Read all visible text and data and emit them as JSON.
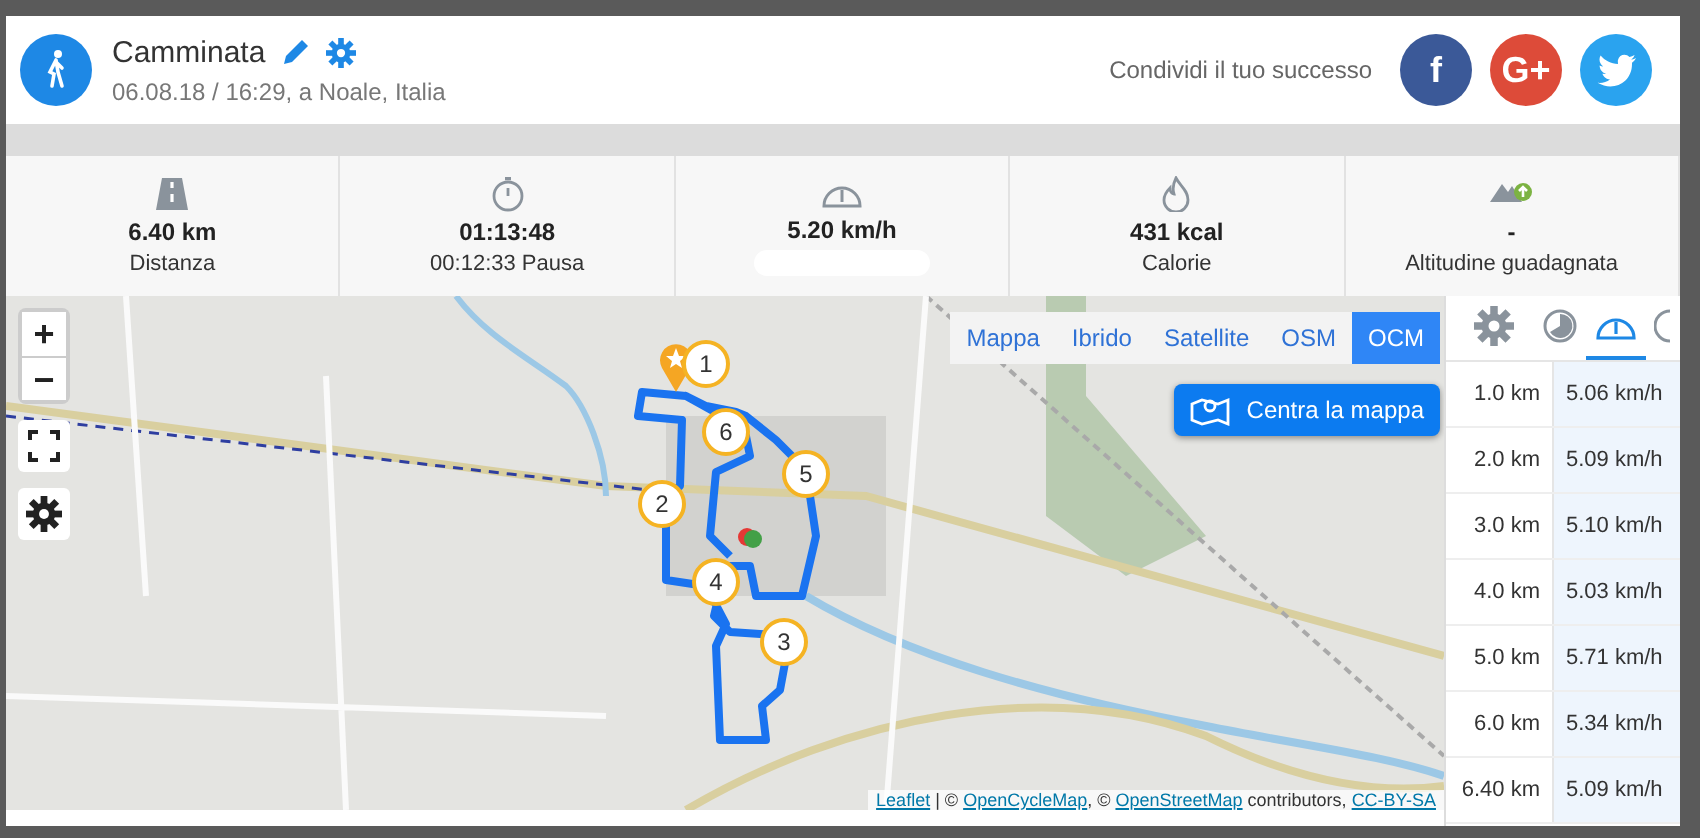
{
  "activity": {
    "title": "Camminata",
    "subtitle": "06.08.18 / 16:29, a Noale, Italia"
  },
  "share": {
    "label": "Condividi il tuo successo",
    "buttons": [
      {
        "kind": "facebook",
        "text": "f"
      },
      {
        "kind": "google",
        "text": "G+"
      },
      {
        "kind": "twitter"
      }
    ]
  },
  "stats": [
    {
      "kind": "distance",
      "value": "6.40 km",
      "label": "Distanza"
    },
    {
      "kind": "duration",
      "value": "01:13:48",
      "label": "00:12:33 Pausa"
    },
    {
      "kind": "speed",
      "value": "5.20 km/h",
      "label_blurred": true
    },
    {
      "kind": "calories",
      "value": "431 kcal",
      "label": "Calorie"
    },
    {
      "kind": "altitude",
      "value": "-",
      "label": "Altitudine guadagnata"
    }
  ],
  "map": {
    "layers": [
      {
        "label": "Mappa",
        "selected": false
      },
      {
        "label": "Ibrido",
        "selected": false
      },
      {
        "label": "Satellite",
        "selected": false
      },
      {
        "label": "OSM",
        "selected": false
      },
      {
        "label": "OCM",
        "selected": true
      }
    ],
    "center_button": "Centra la mappa",
    "zoom_in": "+",
    "zoom_out": "−",
    "markers": [
      "1",
      "2",
      "3",
      "4",
      "5",
      "6"
    ],
    "attribution": [
      {
        "text": "Leaflet",
        "link": true
      },
      {
        "text": " | © ",
        "link": false
      },
      {
        "text": "OpenCycleMap",
        "link": true
      },
      {
        "text": ", © ",
        "link": false
      },
      {
        "text": "OpenStreetMap",
        "link": true
      },
      {
        "text": " contributors, ",
        "link": false
      },
      {
        "text": "CC-BY-SA",
        "link": true
      }
    ]
  },
  "splits": {
    "tabs": [
      {
        "kind": "settings",
        "selected": false
      },
      {
        "kind": "timer",
        "selected": false
      },
      {
        "kind": "speed",
        "selected": true
      },
      {
        "kind": "other",
        "selected": false
      }
    ],
    "rows": [
      {
        "distance": "1.0 km",
        "speed": "5.06 km/h"
      },
      {
        "distance": "2.0 km",
        "speed": "5.09 km/h"
      },
      {
        "distance": "3.0 km",
        "speed": "5.10 km/h"
      },
      {
        "distance": "4.0 km",
        "speed": "5.03 km/h"
      },
      {
        "distance": "5.0 km",
        "speed": "5.71 km/h"
      },
      {
        "distance": "6.0 km",
        "speed": "5.34 km/h"
      },
      {
        "distance": "6.40 km",
        "speed": "5.09 km/h"
      }
    ]
  }
}
